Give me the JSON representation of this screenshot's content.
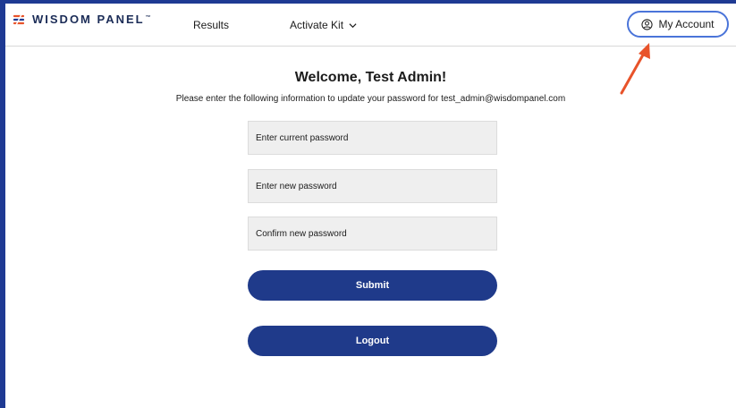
{
  "header": {
    "logo_text": "WISDOM PANEL",
    "logo_tm": "™",
    "logo_icon": "wisdom-panel-mark",
    "nav": {
      "results_label": "Results",
      "activate_kit_label": "Activate Kit"
    },
    "account_label": "My Account",
    "account_icon": "user-circle-icon"
  },
  "annotation": {
    "arrow_color": "#e8532a"
  },
  "main": {
    "welcome": "Welcome, Test Admin!",
    "instructions": "Please enter the following information to update your password for test_admin@wisdompanel.com",
    "fields": {
      "current_password_placeholder": "Enter current password",
      "new_password_placeholder": "Enter new password",
      "confirm_password_placeholder": "Confirm new password"
    },
    "submit_label": "Submit",
    "logout_label": "Logout"
  },
  "colors": {
    "frame_blue": "#1f3a93",
    "button_blue": "#1f3a8a",
    "account_border": "#4a74d9",
    "field_bg": "#efefef"
  }
}
